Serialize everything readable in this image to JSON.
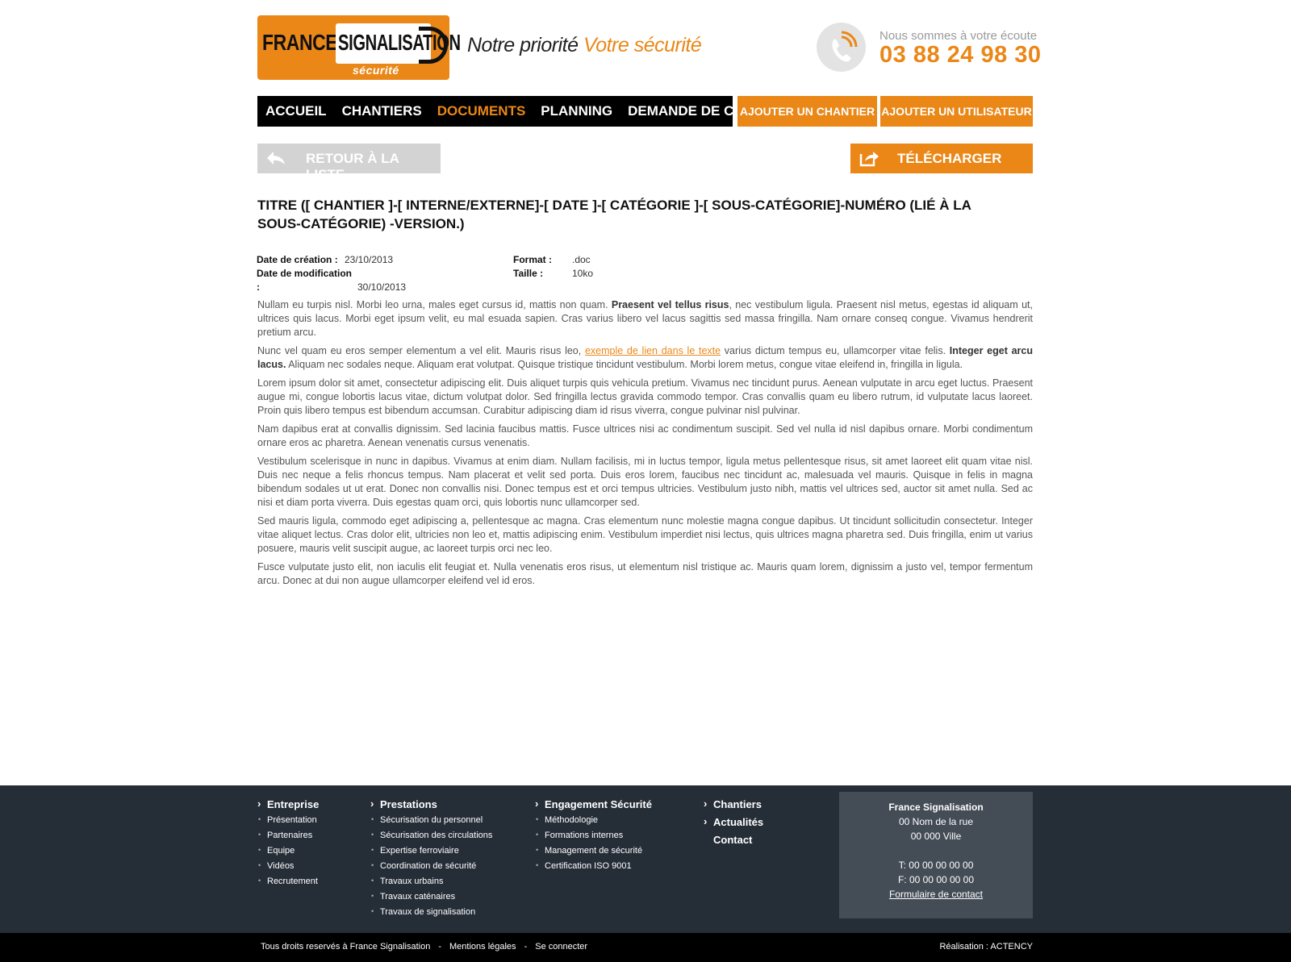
{
  "header": {
    "logo_line1": "FRANCE",
    "logo_line2": "SIGNALISATION",
    "logo_line3": "sécurité",
    "tagline_part1": "Notre priorité ",
    "tagline_part2": "Votre sécurité",
    "listen_label": "Nous sommes à votre écoute",
    "phone": "03 88 24 98 30",
    "phone_icon": "phone-icon"
  },
  "nav": {
    "items": [
      {
        "label": "ACCUEIL",
        "active": false
      },
      {
        "label": "CHANTIERS",
        "active": false
      },
      {
        "label": "DOCUMENTS",
        "active": true
      },
      {
        "label": "PLANNING",
        "active": false
      },
      {
        "label": "DEMANDE DE CONGÉ",
        "active": false
      }
    ],
    "add_site": "AJOUTER UN CHANTIER",
    "add_user": "AJOUTER UN UTILISATEUR"
  },
  "actions": {
    "back_label": "RETOUR À LA LISTE",
    "back_icon": "reply-arrow-icon",
    "download_label": "TÉLÉCHARGER",
    "download_icon": "share-icon"
  },
  "document": {
    "title": "TITRE ([ CHANTIER ]-[ INTERNE/EXTERNE]-[ DATE ]-[ CATÉGORIE ]-[ SOUS-CATÉGORIE]-NUMÉRO (LIÉ À LA SOUS-CATÉGORIE) -VERSION.)",
    "created_label": "Date de création :",
    "created_value": "23/10/2013",
    "modified_label": "Date de modification :",
    "modified_value": "30/10/2013",
    "format_label": "Format :",
    "format_value": ".doc",
    "size_label": "Taille :",
    "size_value": "10ko",
    "p1a": "Nullam eu turpis nisl. Morbi leo urna, males eget cursus id, mattis non quam. ",
    "p1b": "Praesent vel tellus risus",
    "p1c": ", nec vestibulum ligula. Praesent nisl metus, egestas id aliquam ut, ultrices quis lacus. Morbi eget ipsum velit, eu mal esuada sapien. Cras varius libero vel lacus sagittis sed massa fringilla. Nam ornare conseq congue. Vivamus hendrerit pretium arcu.",
    "p2a": "Nunc vel quam eu eros semper elementum a vel elit. Mauris risus leo, ",
    "p2link": "exemple de lien dans le texte",
    "p2b": " varius dictum tempus eu, ullamcorper vitae felis. ",
    "p2bold": "Integer eget arcu lacus.",
    "p2c": " Aliquam nec sodales neque. Aliquam erat volutpat. Quisque tristique tincidunt vestibulum. Morbi lorem metus, congue vitae eleifend in, fringilla in ligula.",
    "p3": "Lorem ipsum dolor sit amet, consectetur adipiscing elit. Duis aliquet turpis quis vehicula pretium. Vivamus nec tincidunt purus. Aenean vulputate in arcu eget luctus. Praesent augue mi, congue lobortis lacus vitae, dictum volutpat dolor. Sed fringilla lectus gravida commodo tempor. Cras convallis quam eu libero rutrum, id vulputate lacus laoreet. Proin quis libero tempus est bibendum accumsan. Curabitur adipiscing diam id risus viverra, congue pulvinar nisl pulvinar.",
    "p4": "Nam dapibus erat at convallis dignissim. Sed lacinia faucibus mattis. Fusce ultrices nisi ac condimentum suscipit. Sed vel nulla id nisl dapibus ornare. Morbi condimentum ornare eros ac pharetra. Aenean venenatis cursus venenatis.",
    "p5": " Vestibulum scelerisque in nunc in dapibus. Vivamus at enim diam. Nullam facilisis, mi in luctus tempor, ligula metus pellentesque risus, sit amet laoreet elit quam vitae nisl. Duis nec neque a felis rhoncus tempus. Nam placerat et velit sed porta. Duis eros lorem, faucibus nec tincidunt ac, malesuada vel mauris. Quisque in felis in magna bibendum sodales ut ut erat. Donec non convallis nisi. Donec tempus est et orci tempus ultricies. Vestibulum justo nibh, mattis vel ultrices sed, auctor sit amet nulla. Sed ac nisi et diam porta viverra. Duis egestas quam orci, quis lobortis nunc ullamcorper sed.",
    "p6": "Sed mauris ligula, commodo eget adipiscing a, pellentesque ac magna. Cras elementum nunc molestie magna congue dapibus. Ut tincidunt sollicitudin consectetur. Integer vitae aliquet lectus. Cras dolor elit, ultricies non leo et, mattis adipiscing enim. Vestibulum imperdiet nisi lectus, quis ultrices magna pharetra sed. Duis fringilla, enim ut varius posuere, mauris velit suscipit augue, ac laoreet turpis orci nec leo.",
    "p7": "Fusce vulputate justo elit, non iaculis elit feugiat et. Nulla venenatis eros risus, ut elementum nisl tristique ac. Mauris quam lorem, dignissim a justo vel, tempor fermentum arcu. Donec at dui non augue ullamcorper eleifend vel id eros."
  },
  "footer": {
    "col1": {
      "heading": "Entreprise",
      "items": [
        "Présentation",
        "Partenaires",
        "Equipe",
        "Vidéos",
        "Recrutement"
      ]
    },
    "col2": {
      "heading": "Prestations",
      "items": [
        "Sécurisation du personnel",
        "Sécurisation des circulations",
        "Expertise ferroviaire",
        "Coordination de sécurité",
        "Travaux urbains",
        "Travaux caténaires",
        "Travaux de signalisation"
      ]
    },
    "col3": {
      "heading": "Engagement Sécurité",
      "items": [
        "Méthodologie",
        "Formations internes",
        "Management de sécurité",
        "Certification ISO 9001"
      ]
    },
    "col4": {
      "headings": [
        "Chantiers",
        "Actualités",
        "Contact"
      ]
    },
    "contact": {
      "name": "France Signalisation",
      "street": "00 Nom de la rue",
      "city": "00 000 Ville",
      "tel": "T: 00 00 00 00 00",
      "fax": "F: 00 00 00 00 00",
      "form_link": "Formulaire de contact"
    },
    "bottom": {
      "rights": "Tous droits reservés à France Signalisation",
      "sep": "-",
      "legal": "Mentions légales",
      "login": "Se connecter",
      "credit": "Réalisation : ACTENCY"
    }
  },
  "colors": {
    "accent": "#ea8717",
    "nav_bg": "#000000",
    "footer_bg": "#252d37",
    "contact_bg": "#444c56"
  }
}
